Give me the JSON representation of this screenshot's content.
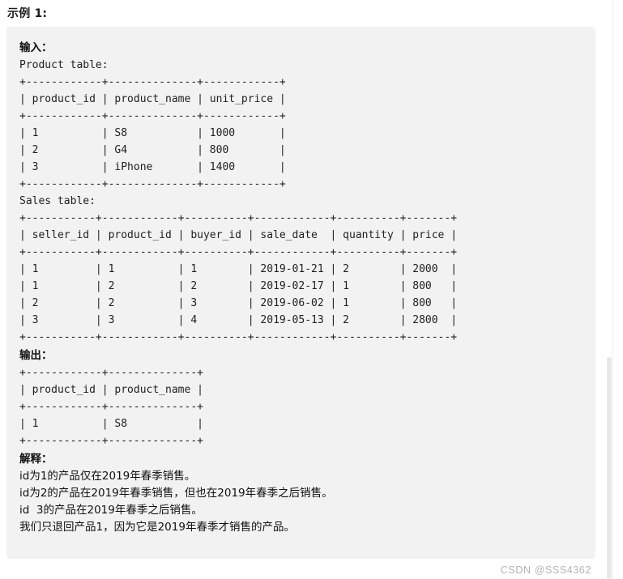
{
  "page": {
    "example_title": "示例 1:",
    "watermark": "CSDN @SSS4362"
  },
  "input_section": {
    "label": "输入：",
    "product_table_caption": "Product table:",
    "product_table_ascii": "+------------+--------------+------------+\n| product_id | product_name | unit_price |\n+------------+--------------+------------+\n| 1          | S8           | 1000       |\n| 2          | G4           | 800        |\n| 3          | iPhone       | 1400       |\n+------------+--------------+------------+",
    "sales_table_caption": "Sales table:",
    "sales_table_ascii": "+-----------+------------+----------+------------+----------+-------+\n| seller_id | product_id | buyer_id | sale_date  | quantity | price |\n+-----------+------------+----------+------------+----------+-------+\n| 1         | 1          | 1        | 2019-01-21 | 2        | 2000  |\n| 1         | 2          | 2        | 2019-02-17 | 1        | 800   |\n| 2         | 2          | 3        | 2019-06-02 | 1        | 800   |\n| 3         | 3          | 4        | 2019-05-13 | 2        | 2800  |\n+-----------+------------+----------+------------+----------+-------+"
  },
  "output_section": {
    "label": "输出：",
    "table_ascii": "+------------+--------------+\n| product_id | product_name |\n+------------+--------------+\n| 1          | S8           |\n+------------+--------------+"
  },
  "explanation_section": {
    "label": "解释：",
    "lines": [
      "id为1的产品仅在2019年春季销售。",
      "id为2的产品在2019年春季销售，但也在2019年春季之后销售。",
      "id  3的产品在2019年春季之后销售。",
      "我们只退回产品1，因为它是2019年春季才销售的产品。"
    ]
  },
  "tables_data": {
    "product": {
      "columns": [
        "product_id",
        "product_name",
        "unit_price"
      ],
      "rows": [
        [
          "1",
          "S8",
          "1000"
        ],
        [
          "2",
          "G4",
          "800"
        ],
        [
          "3",
          "iPhone",
          "1400"
        ]
      ]
    },
    "sales": {
      "columns": [
        "seller_id",
        "product_id",
        "buyer_id",
        "sale_date",
        "quantity",
        "price"
      ],
      "rows": [
        [
          "1",
          "1",
          "1",
          "2019-01-21",
          "2",
          "2000"
        ],
        [
          "1",
          "2",
          "2",
          "2019-02-17",
          "1",
          "800"
        ],
        [
          "2",
          "2",
          "3",
          "2019-06-02",
          "1",
          "800"
        ],
        [
          "3",
          "3",
          "4",
          "2019-05-13",
          "2",
          "2800"
        ]
      ]
    },
    "output": {
      "columns": [
        "product_id",
        "product_name"
      ],
      "rows": [
        [
          "1",
          "S8"
        ]
      ]
    }
  },
  "colors": {
    "card_background": "#f2f2f2",
    "page_background": "#ffffff",
    "text": "#1f1f1f",
    "watermark": "#b4b4b4"
  }
}
